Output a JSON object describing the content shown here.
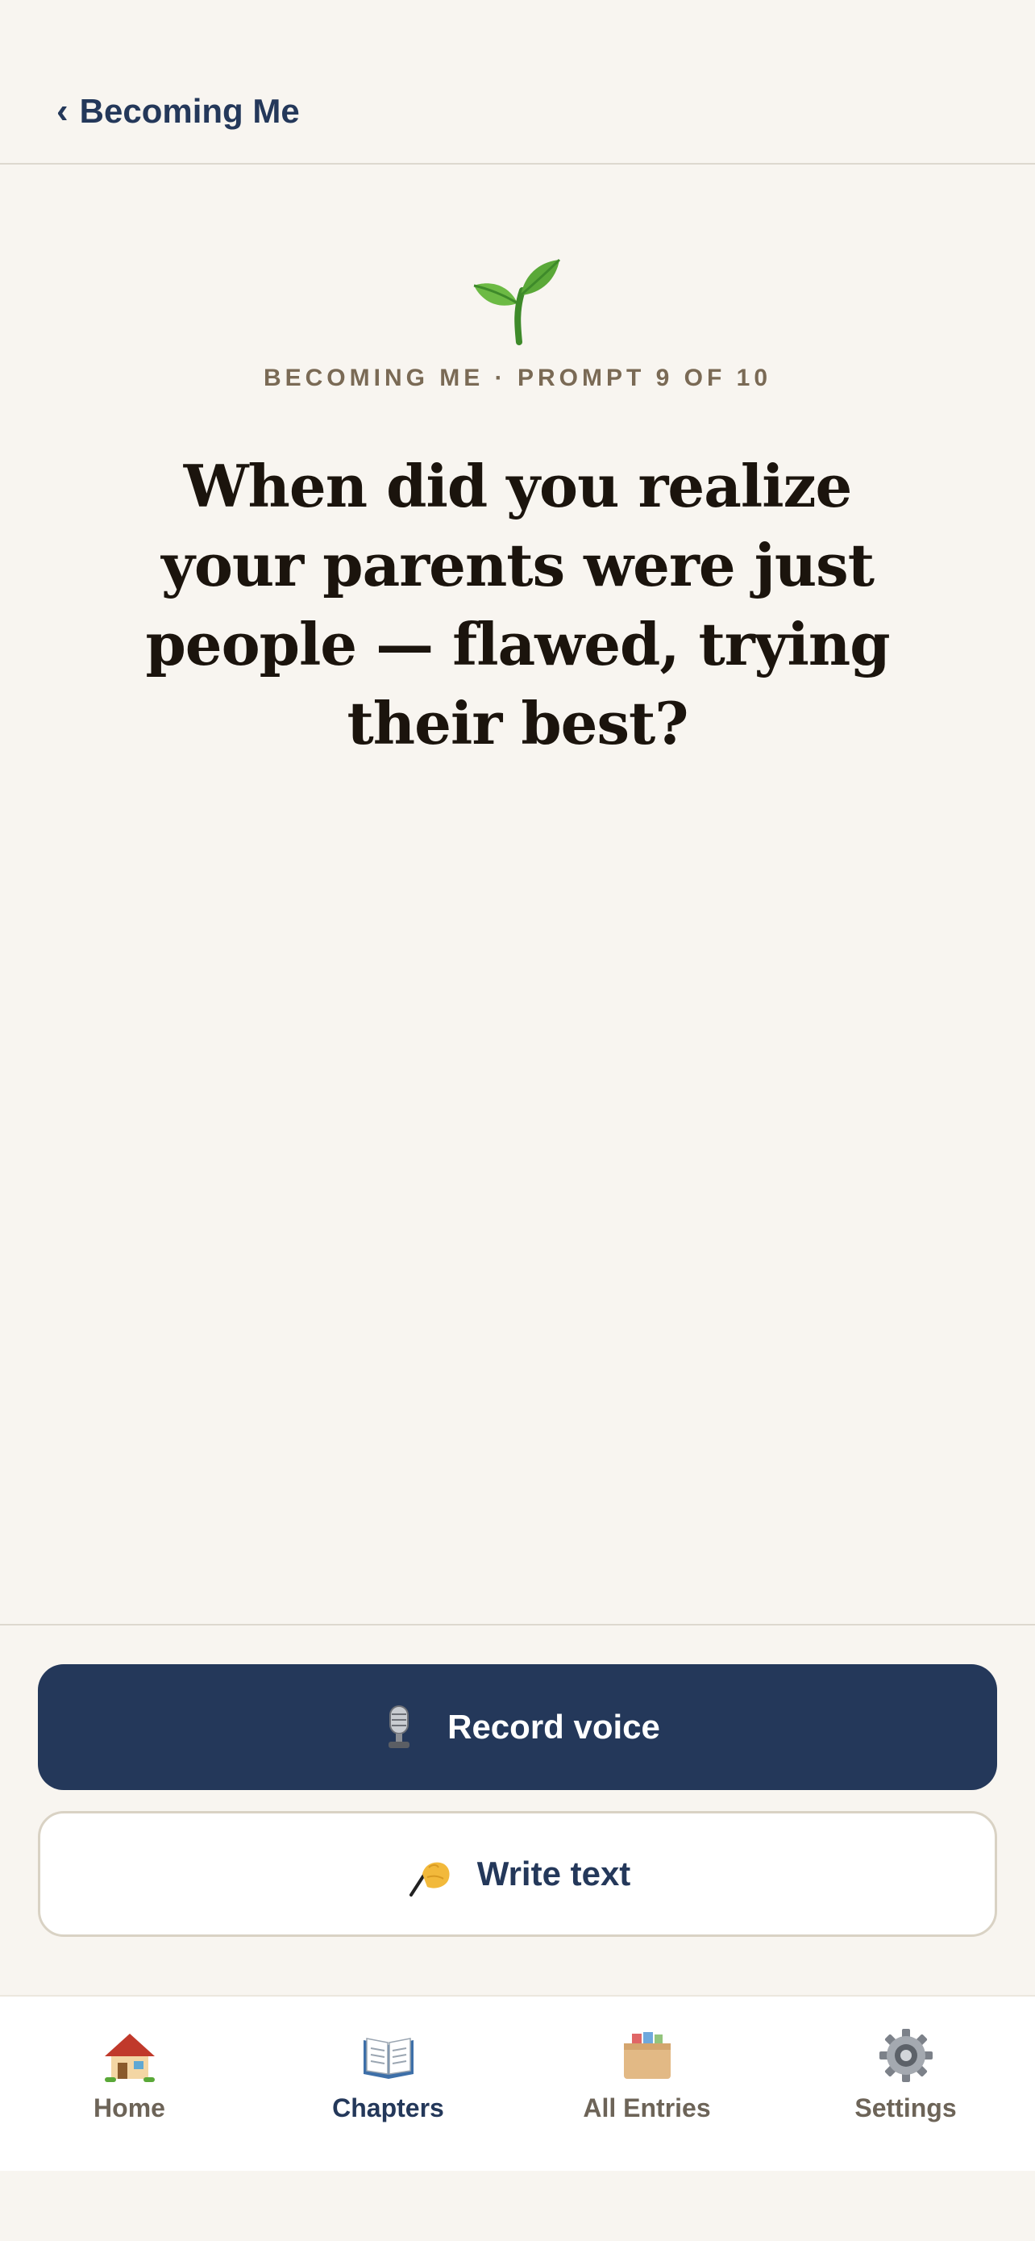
{
  "header": {
    "back_label": "Becoming Me",
    "back_icon": "chevron-left-icon"
  },
  "prompt": {
    "icon": "sprout-icon",
    "meta": "BECOMING ME · PROMPT 9 OF 10",
    "question": "When did you realize your parents were just people — flawed, trying their best?"
  },
  "actions": {
    "record_label": "Record voice",
    "record_icon": "microphone-icon",
    "write_label": "Write text",
    "write_icon": "writing-hand-icon"
  },
  "tabs": [
    {
      "label": "Home",
      "icon": "house-icon",
      "active": false
    },
    {
      "label": "Chapters",
      "icon": "open-book-icon",
      "active": true
    },
    {
      "label": "All Entries",
      "icon": "card-file-box-icon",
      "active": false
    },
    {
      "label": "Settings",
      "icon": "gear-icon",
      "active": false
    }
  ],
  "colors": {
    "background": "#f8f5f0",
    "primary": "#24385a",
    "meta_text": "#7a6a55",
    "question_text": "#1b140d"
  }
}
